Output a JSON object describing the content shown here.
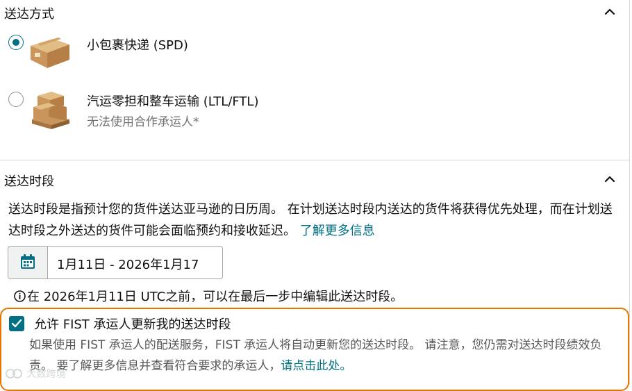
{
  "shipping_method": {
    "title": "送达方式",
    "options": [
      {
        "label": "小包裹快递 (SPD)",
        "sub": "",
        "selected": true,
        "icon": "small-box-icon"
      },
      {
        "label": "汽运零担和整车运输 (LTL/FTL)",
        "sub": "无法使用合作承运人*",
        "selected": false,
        "icon": "pallet-icon"
      }
    ]
  },
  "delivery_window": {
    "title": "送达时段",
    "desc_text": "送达时段是指预计您的货件送达亚马逊的日历周。 在计划送达时段内送达的货件将获得优先处理，而在计划送达时段之外送达的货件可能会面临预约和接收延迟。 ",
    "learn_more": "了解更多信息",
    "date_range": "1月11日 - 2026年1月17",
    "info": "在 2026年1月11日 UTC之前，可以在最后一步中编辑此送达时段。"
  },
  "fist": {
    "checkbox_label": "允许 FIST 承运人更新我的送达时段",
    "checked": true,
    "desc": "如果使用 FIST 承运人的配送服务，FIST 承运人将自动更新您的送达时段。 请注意，您仍需对送达时段绩效负责。 要了解更多信息并查看符合要求的承运人，",
    "link": "请点击此处。"
  },
  "watermark": "大数跨境",
  "colors": {
    "accent": "#007185",
    "focus_border": "#e77600",
    "divider": "#d5d9d9"
  }
}
